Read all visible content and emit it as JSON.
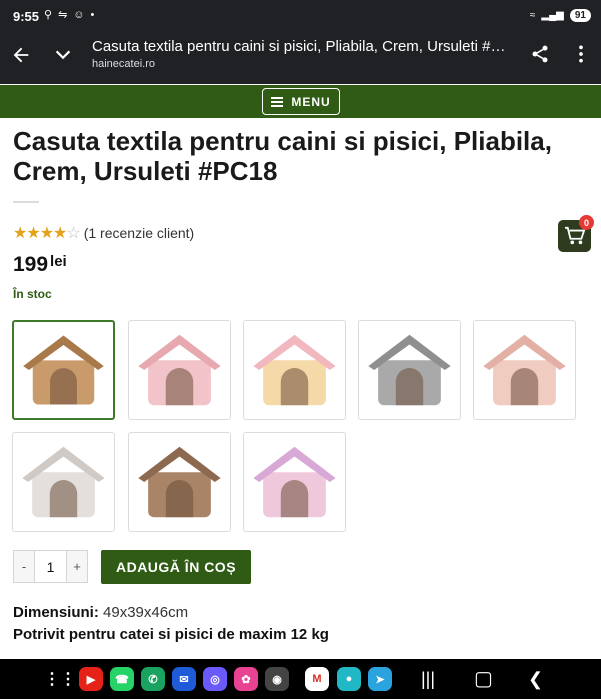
{
  "status": {
    "time": "9:55",
    "battery": "91"
  },
  "browser": {
    "page_title": "Casuta textila pentru caini si pisici, Pliabila, Crem, Ursuleti #PC18",
    "domain": "hainecatei.ro"
  },
  "header": {
    "menu_label": "MENU"
  },
  "product": {
    "title": "Casuta textila pentru caini si pisici, Pliabila, Crem, Ursuleti #PC18",
    "rating": 4,
    "review_text": "(1 recenzie client)",
    "price": "199",
    "currency": "lei",
    "stock": "În stoc",
    "cart_count": "0",
    "quantity": "1",
    "qty_minus": "-",
    "qty_plus": "+",
    "add_to_cart": "ADAUGĂ ÎN COȘ",
    "dimensions_label": "Dimensiuni:",
    "dimensions_value": "49x39x46cm",
    "fit_text": "Potrivit pentru catei si pisici de maxim 12 kg"
  },
  "thumbnails": [
    {
      "color": "#c99a6a",
      "roof": "#a9784b",
      "label": "beige-bear-house"
    },
    {
      "color": "#f2c3c8",
      "roof": "#e7a8b0",
      "label": "pink-strawberry-house"
    },
    {
      "color": "#f6d9a8",
      "roof": "#f1b8c0",
      "label": "pastel-rainbow-house"
    },
    {
      "color": "#a9a9a9",
      "roof": "#8f8f8f",
      "label": "grey-elephant-house"
    },
    {
      "color": "#efcbc0",
      "roof": "#e3b0a6",
      "label": "pink-fluffy-house"
    },
    {
      "color": "#e3e0dc",
      "roof": "#cfcac5",
      "label": "white-fluffy-house"
    },
    {
      "color": "#a98467",
      "roof": "#8d6a4f",
      "label": "brown-fluffy-house"
    },
    {
      "color": "#f0c8dc",
      "roof": "#d8a8d6",
      "label": "tie-dye-house"
    }
  ],
  "colors": {
    "brand_green": "#2f5b14",
    "star": "#e3a21a",
    "badge": "#e53935"
  }
}
